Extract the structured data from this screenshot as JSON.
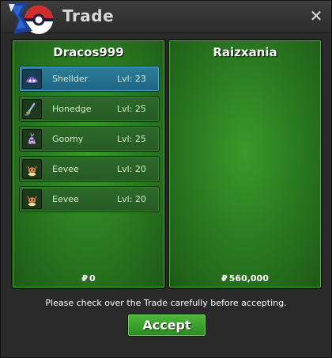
{
  "window": {
    "title": "Trade",
    "close_label": "✕"
  },
  "trade": {
    "left": {
      "name": "Dracos999",
      "money_symbol": "₽",
      "money": "0",
      "pokemon": [
        {
          "name": "Shellder",
          "level": "Lvl: 23",
          "icon": "shellder-icon",
          "selected": true
        },
        {
          "name": "Honedge",
          "level": "Lvl: 25",
          "icon": "honedge-icon",
          "selected": false
        },
        {
          "name": "Goomy",
          "level": "Lvl: 25",
          "icon": "goomy-icon",
          "selected": false
        },
        {
          "name": "Eevee",
          "level": "Lvl: 20",
          "icon": "eevee-icon",
          "selected": false
        },
        {
          "name": "Eevee",
          "level": "Lvl: 20",
          "icon": "eevee-icon",
          "selected": false
        }
      ]
    },
    "right": {
      "name": "Raizxania",
      "money_symbol": "₽",
      "money": "560,000",
      "pokemon": []
    }
  },
  "notice": "Please check over the Trade carefully before accepting.",
  "accept_label": "Accept",
  "colors": {
    "panel_green": "#2b7d21",
    "selected_blue": "#1e6485",
    "accept_green": "#3aa02e"
  }
}
